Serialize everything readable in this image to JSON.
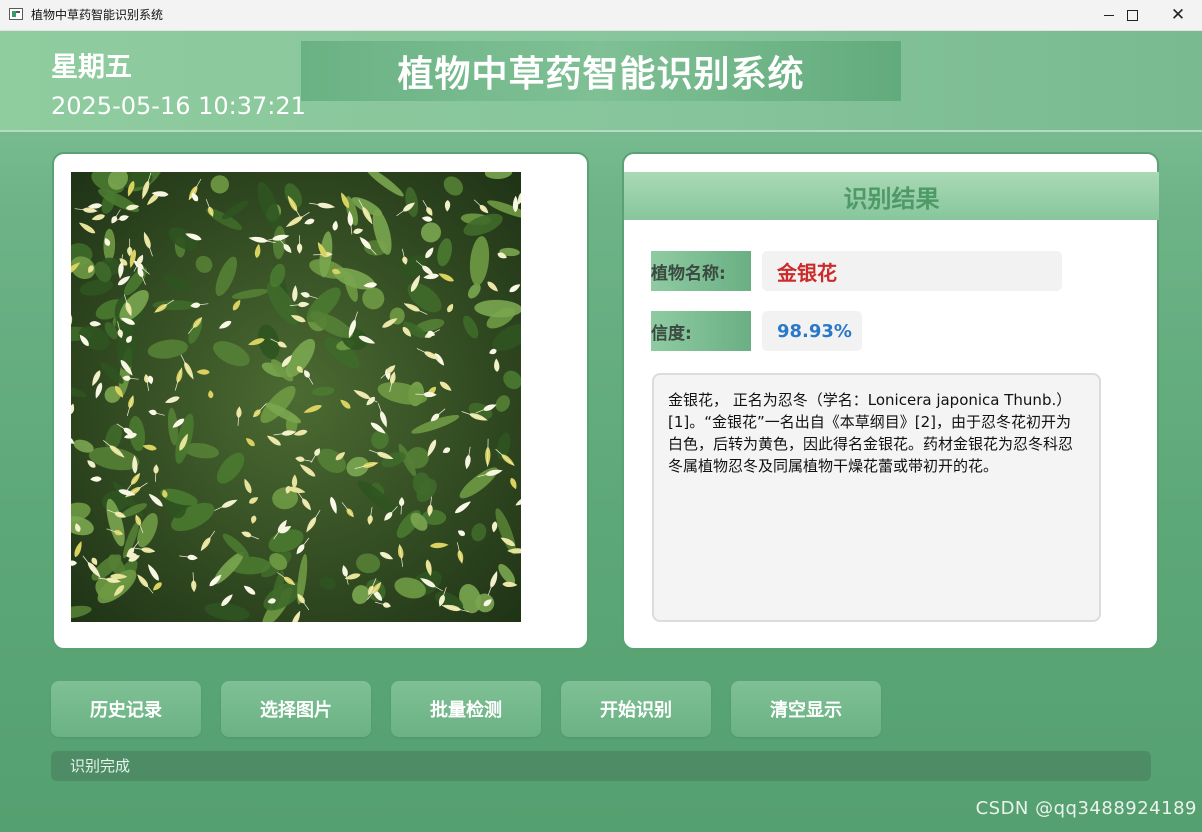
{
  "window": {
    "title": "植物中草药智能识别系统",
    "controls": {
      "minimize_icon": "minimize-icon",
      "maximize_icon": "maximize-icon",
      "close_icon": "close-icon"
    }
  },
  "header": {
    "weekday": "星期五",
    "datetime": "2025-05-16 10:37:21",
    "title": "植物中草药智能识别系统"
  },
  "image_panel": {
    "image_subject": "honeysuckle flowers photo"
  },
  "result": {
    "title": "识别结果",
    "name_label": "植物名称:",
    "name_value": "金银花",
    "confidence_label": "置信度:",
    "confidence_value": "98.93%",
    "description": "金银花， 正名为忍冬（学名：Lonicera japonica Thunb.）[1]。“金银花”一名出自《本草纲目》[2]，由于忍冬花初开为白色，后转为黄色，因此得名金银花。药材金银花为忍冬科忍冬属植物忍冬及同属植物干燥花蕾或带初开的花。"
  },
  "buttons": {
    "history": "历史记录",
    "select_image": "选择图片",
    "batch_detect": "批量检测",
    "start_recognition": "开始识别",
    "clear_display": "清空显示"
  },
  "status": {
    "text": "识别完成"
  },
  "watermark": "CSDN @qq3488924189",
  "colors": {
    "accent_green": "#6ab283",
    "name_red": "#cc2b2b",
    "confidence_blue": "#2c78c8",
    "result_title_green": "#4e9a66"
  }
}
